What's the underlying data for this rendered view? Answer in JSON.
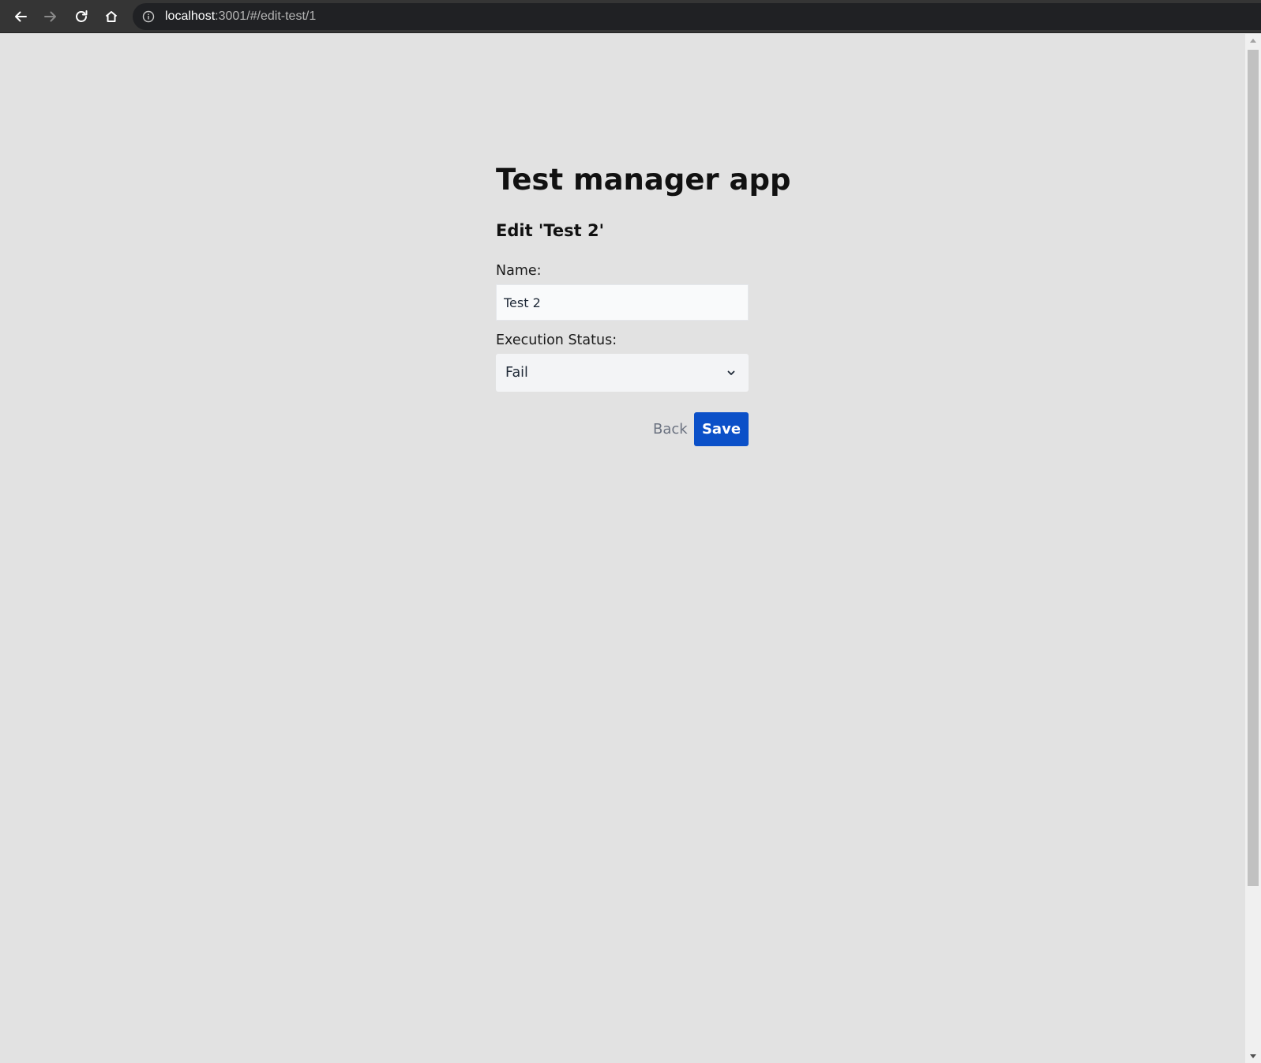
{
  "browser": {
    "url_host": "localhost",
    "url_rest": ":3001/#/edit-test/1"
  },
  "page": {
    "title": "Test manager app",
    "subtitle": "Edit 'Test 2'"
  },
  "form": {
    "name_label": "Name:",
    "name_value": "Test 2",
    "status_label": "Execution Status:",
    "status_value": "Fail"
  },
  "actions": {
    "back_label": "Back",
    "save_label": "Save"
  },
  "colors": {
    "page_background": "#e2e2e2",
    "save_button": "#0b50c8",
    "back_text": "#6b7280",
    "browser_bar": "#353535"
  }
}
